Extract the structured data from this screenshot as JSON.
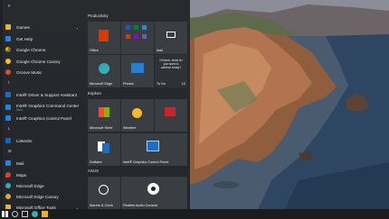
{
  "apps": [
    {
      "label": "Games",
      "icon": "folder-icon",
      "color": "#e3b341",
      "expand": true
    },
    {
      "label": "Get Help",
      "icon": "help-icon",
      "color": "#2f7fd6"
    },
    {
      "label": "Google Chrome",
      "icon": "chrome-icon",
      "color": "#e6b022"
    },
    {
      "label": "Google Chrome Canary",
      "icon": "chrome-canary-icon",
      "color": "#f2c12e"
    },
    {
      "label": "Groove Music",
      "icon": "music-icon",
      "color": "#d4513b"
    },
    {
      "label": "Intel® Driver & Support Assistant",
      "icon": "intel-icon",
      "color": "#1f6dc0"
    },
    {
      "label": "Intel® Graphics Command Center",
      "icon": "intel-graphics-icon",
      "color": "#2a7fd0",
      "sub": "New"
    },
    {
      "label": "Intel® Graphics Control Panel",
      "icon": "intel-panel-icon",
      "color": "#2a7fd0"
    },
    {
      "label": "LinkedIn",
      "icon": "linkedin-icon",
      "color": "#0a66c2"
    },
    {
      "label": "Mail",
      "icon": "mail-icon",
      "color": "#2f7fd6"
    },
    {
      "label": "Maps",
      "icon": "maps-icon",
      "color": "#d8413b"
    },
    {
      "label": "Microsoft Edge",
      "icon": "edge-icon",
      "color": "#2a9ad8"
    },
    {
      "label": "Microsoft Edge Canary",
      "icon": "edge-canary-icon",
      "color": "#e0a82e"
    },
    {
      "label": "Microsoft Office Tools",
      "icon": "folder-icon",
      "color": "#e3b341",
      "expand": true
    }
  ],
  "letters": {
    "h": "#",
    "i": "I",
    "l": "L",
    "m": "M"
  },
  "groups": {
    "productivity": "Productivity",
    "explore": "Explore",
    "asus": "ASUS"
  },
  "tiles": {
    "office": "Office",
    "mail": "Mail",
    "edge": "Microsoft Edge",
    "photos": "Photos",
    "todo": "To Do",
    "todo_msg": "Hi there, what do you want to achieve today?",
    "todo_count": "12",
    "store": "Microsoft Store",
    "weather": "Weather",
    "solitaire": "Solitaire",
    "intel_panel": "Intel® Graphics Control Panel",
    "alarms": "Alarms & Clock",
    "realtek": "Realtek Audio Console"
  },
  "colors": {
    "accent": "#2f7fd6"
  }
}
